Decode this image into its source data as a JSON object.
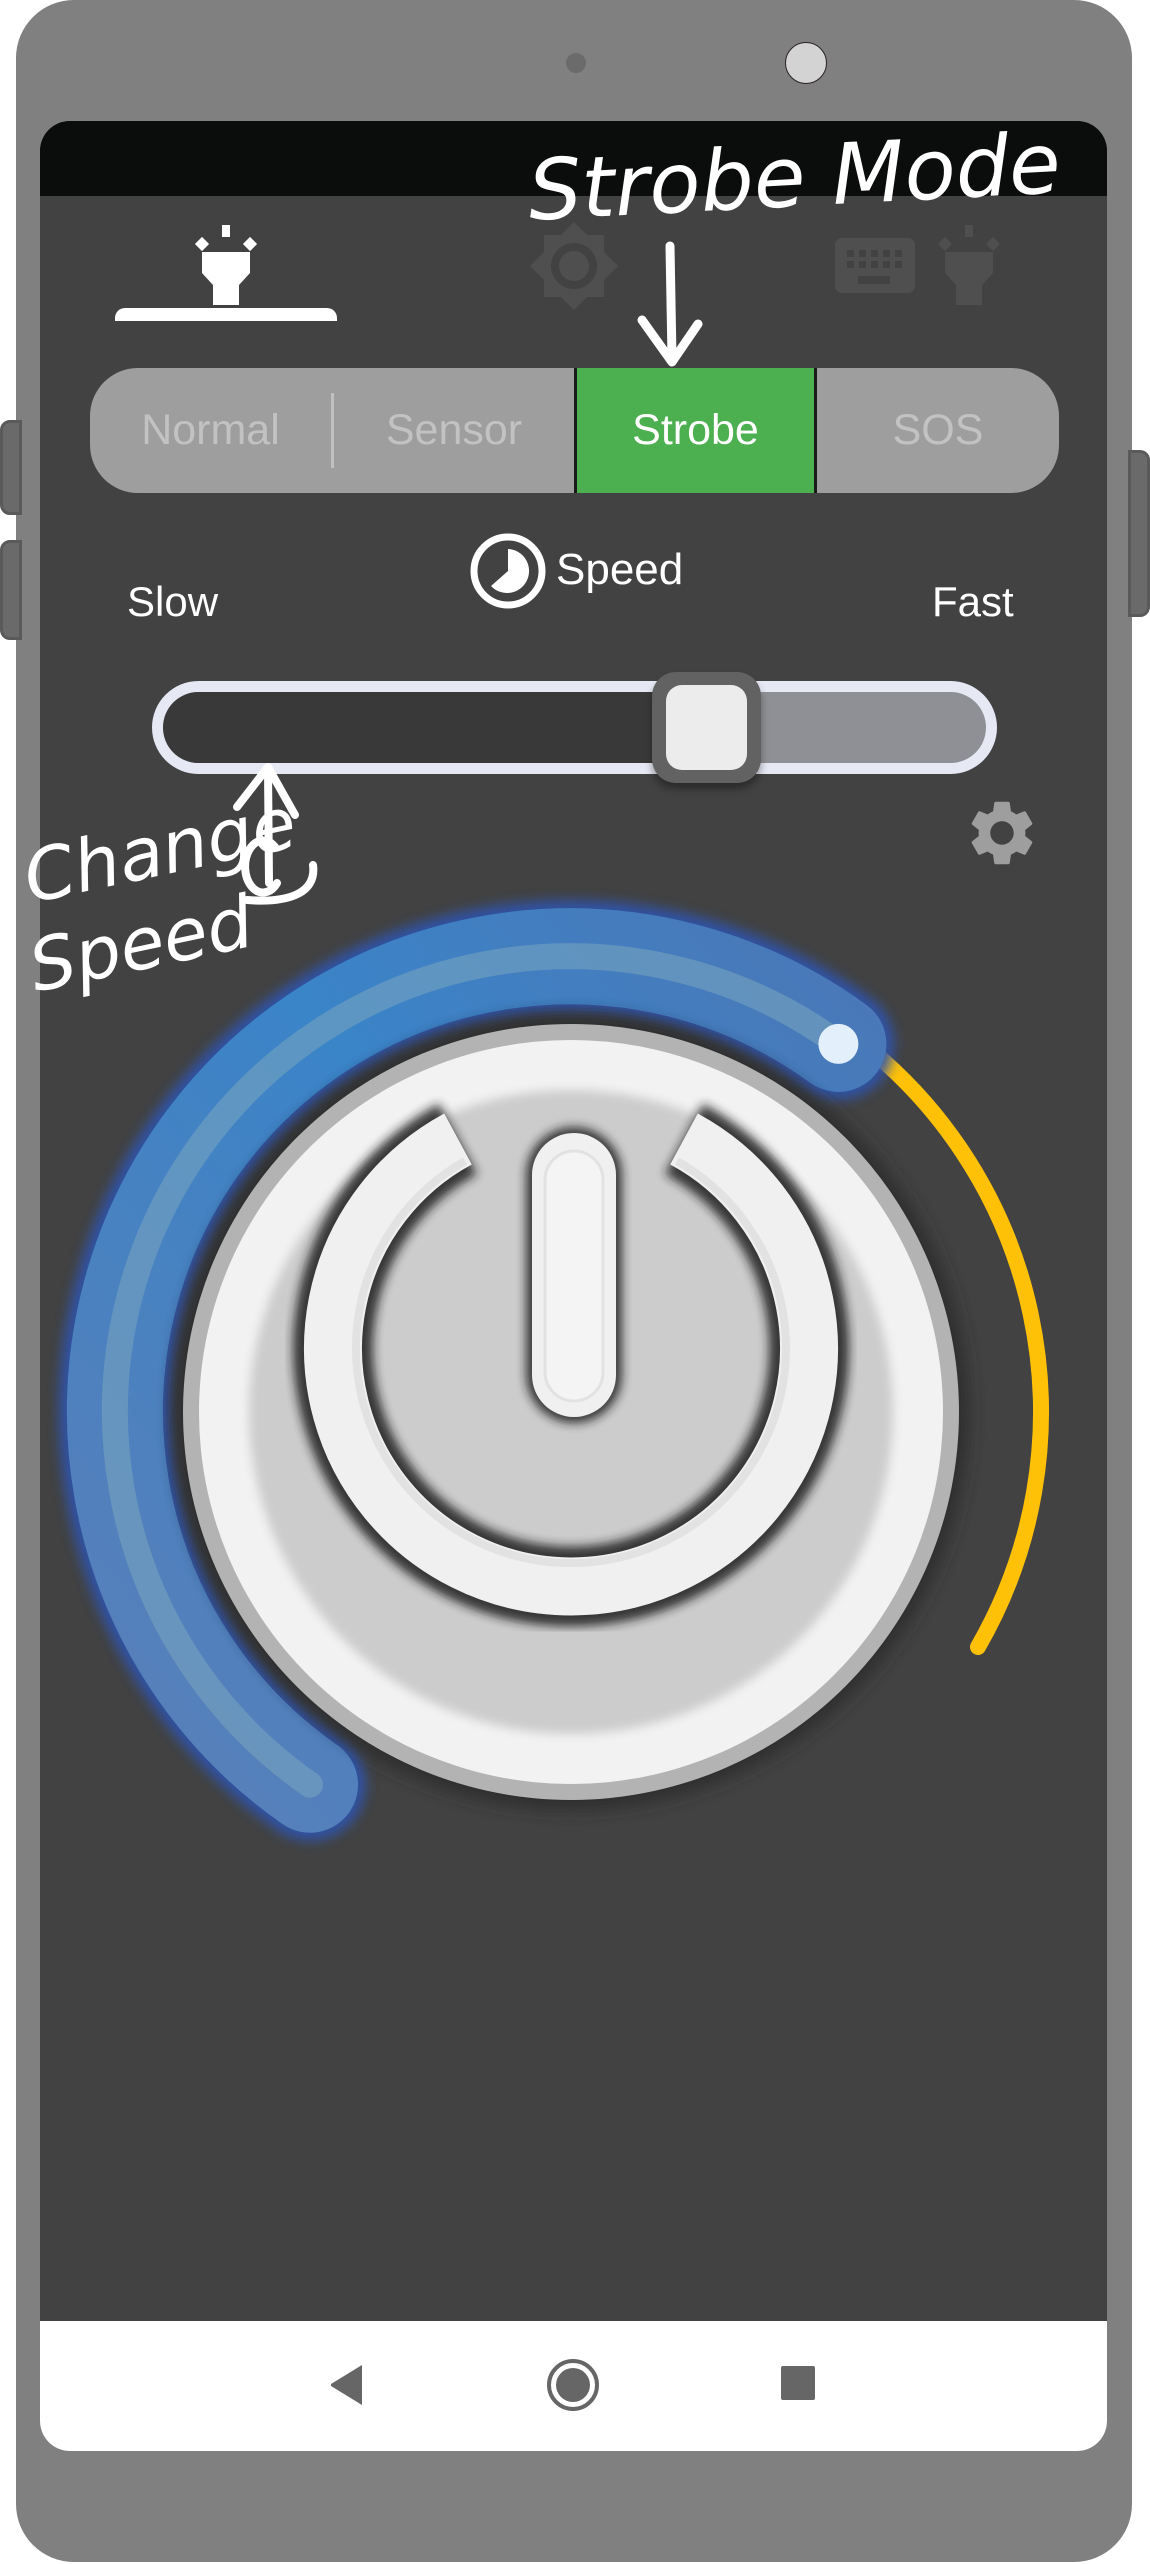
{
  "app": {
    "top_tabs": [
      {
        "id": "flashlight",
        "icon": "flashlight-icon",
        "active": true
      },
      {
        "id": "screen-light",
        "icon": "brightness-icon",
        "active": false
      },
      {
        "id": "keyboard-light",
        "icon": "keyboard-flashlight-icon",
        "active": false
      }
    ],
    "modes": [
      {
        "label": "Normal",
        "active": false
      },
      {
        "label": "Sensor",
        "active": false
      },
      {
        "label": "Strobe",
        "active": true
      },
      {
        "label": "SOS",
        "active": false
      }
    ],
    "speed": {
      "title": "Speed",
      "icon": "timer-icon",
      "min_label": "Slow",
      "max_label": "Fast",
      "value": 0.66
    },
    "settings_icon": "gear-icon",
    "power": {
      "icon": "power-icon",
      "brightness_level": 0.62
    }
  },
  "annotations": {
    "mode_callout": "Strobe Mode",
    "speed_callout_line1": "Change",
    "speed_callout_line2": "Speed"
  },
  "nav": {
    "back": "back-icon",
    "home": "home-icon",
    "recents": "recents-icon"
  },
  "colors": {
    "accent_active": "#4caf50",
    "gauge_blue": "#3a7ec6",
    "gauge_track": "#ffc107",
    "app_bg": "#424242"
  }
}
